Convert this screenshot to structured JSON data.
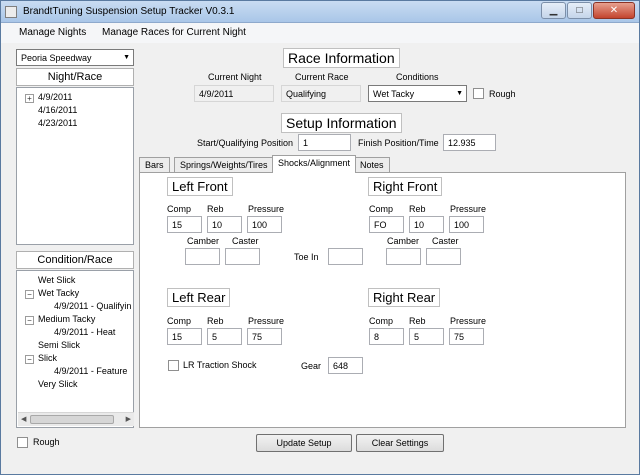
{
  "window": {
    "title": "BrandtTuning Suspension Setup Tracker V0.3.1"
  },
  "menu": [
    "Manage Nights",
    "Manage Races for Current Night"
  ],
  "track": {
    "selected": "Peoria Speedway"
  },
  "night_race": {
    "header": "Night/Race",
    "nodes": [
      {
        "label": "4/9/2011",
        "expander": "+"
      },
      {
        "label": "4/16/2011"
      },
      {
        "label": "4/23/2011"
      }
    ]
  },
  "condition_race": {
    "header": "Condition/Race",
    "nodes": [
      {
        "label": "Wet Slick"
      },
      {
        "label": "Wet Tacky",
        "expander": "−"
      },
      {
        "label": "4/9/2011 - Qualifyin"
      },
      {
        "label": "Medium Tacky",
        "expander": "−"
      },
      {
        "label": "4/9/2011 - Heat"
      },
      {
        "label": "Semi Slick"
      },
      {
        "label": "Slick",
        "expander": "−"
      },
      {
        "label": "4/9/2011 - Feature"
      },
      {
        "label": "Very Slick"
      }
    ]
  },
  "rough_bottom": {
    "label": "Rough"
  },
  "race_info": {
    "title": "Race Information",
    "current_night_label": "Current Night",
    "current_race_label": "Current Race",
    "conditions_label": "Conditions",
    "current_night": "4/9/2011",
    "current_race": "Qualifying",
    "conditions": "Wet Tacky",
    "rough_label": "Rough"
  },
  "setup_info": {
    "title": "Setup Information",
    "start_label": "Start/Qualifying Position",
    "start_value": "1",
    "finish_label": "Finish Position/Time",
    "finish_value": "12.935"
  },
  "tabs": [
    "Bars",
    "Springs/Weights/Tires",
    "Shocks/Alignment",
    "Notes"
  ],
  "shocks": {
    "comp_label": "Comp",
    "reb_label": "Reb",
    "pressure_label": "Pressure",
    "camber_label": "Camber",
    "caster_label": "Caster",
    "toe_in_label": "Toe In",
    "left_front": {
      "title": "Left Front",
      "comp": "15",
      "reb": "10",
      "pressure": "100"
    },
    "right_front": {
      "title": "Right Front",
      "comp": "FO",
      "reb": "10",
      "pressure": "100"
    },
    "left_rear": {
      "title": "Left Rear",
      "comp": "15",
      "reb": "5",
      "pressure": "75"
    },
    "right_rear": {
      "title": "Right Rear",
      "comp": "8",
      "reb": "5",
      "pressure": "75"
    },
    "lr_traction_label": "LR Traction Shock",
    "gear_label": "Gear",
    "gear_value": "648"
  },
  "buttons": {
    "update": "Update Setup",
    "clear": "Clear Settings"
  },
  "icons": [
    "app-icon",
    "minimize-icon",
    "maximize-icon",
    "close-icon",
    "chevron-down-icon"
  ]
}
